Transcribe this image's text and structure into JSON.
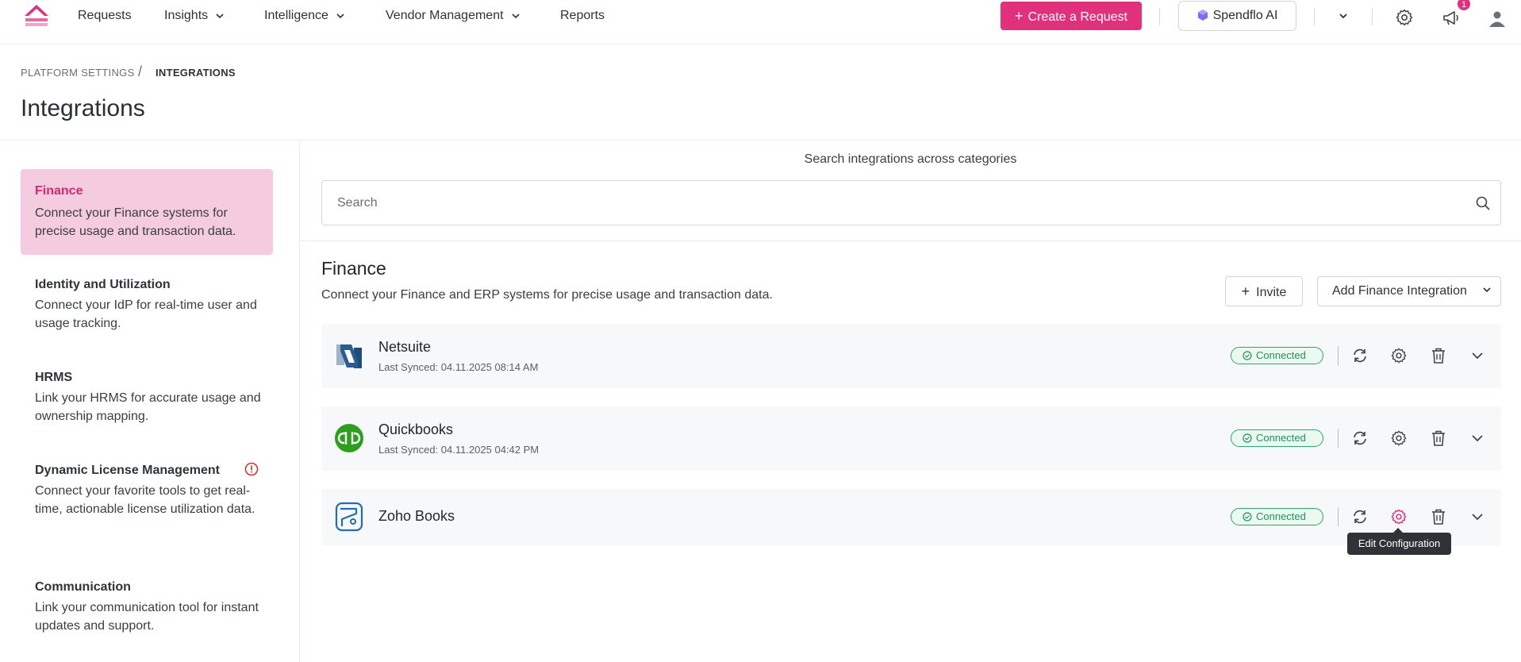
{
  "nav": {
    "items": [
      "Requests",
      "Insights",
      "Intelligence",
      "Vendor Management",
      "Reports"
    ],
    "create_label": "Create a Request",
    "ai_label": "Spendflo AI",
    "notification_count": "1",
    "brand_color": "#e1307c"
  },
  "breadcrumb": {
    "parent": "PLATFORM SETTINGS",
    "separator": "/",
    "current": "INTEGRATIONS"
  },
  "page_title": "Integrations",
  "sidebar": {
    "categories": [
      {
        "title": "Finance",
        "desc": "Connect your Finance systems for precise usage and transaction data.",
        "active": true
      },
      {
        "title": "Identity and Utilization",
        "desc": "Connect your IdP for real-time user and usage tracking."
      },
      {
        "title": "HRMS",
        "desc": "Link your HRMS for accurate usage and ownership mapping."
      },
      {
        "title": "Dynamic License Management",
        "desc": "Connect your favorite tools to get real-time, actionable license utilization data.",
        "warning": true
      },
      {
        "title": "Communication",
        "desc": "Link your communication tool for instant updates and support."
      }
    ]
  },
  "search": {
    "caption": "Search integrations across categories",
    "placeholder": "Search"
  },
  "section": {
    "title": "Finance",
    "desc": "Connect your Finance and ERP systems for precise usage and transaction data.",
    "invite_label": "Invite",
    "add_label": "Add Finance Integration"
  },
  "integrations": [
    {
      "name": "Netsuite",
      "last_synced": "Last Synced: 04.11.2025 08:14 AM",
      "status": "Connected",
      "icon": "netsuite-logo"
    },
    {
      "name": "Quickbooks",
      "last_synced": "Last Synced: 04.11.2025 04:42 PM",
      "status": "Connected",
      "icon": "quickbooks-logo"
    },
    {
      "name": "Zoho Books",
      "status": "Connected",
      "icon": "zoho-books-logo"
    }
  ],
  "tooltip": "Edit Configuration",
  "colors": {
    "accent": "#e1307c",
    "active_bg": "#f5cbdf",
    "connected": "#23915b"
  }
}
